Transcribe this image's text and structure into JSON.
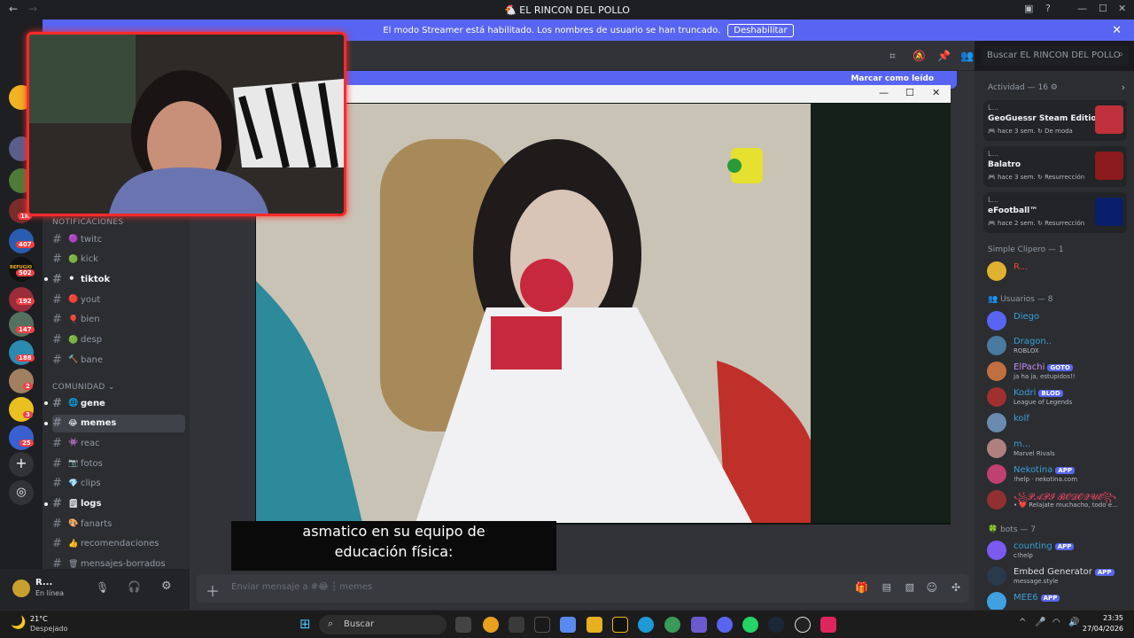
{
  "window": {
    "title": "EL RINCON DEL POLLO"
  },
  "banner": {
    "text": "El modo Streamer está habilitado. Los nombres de usuario se han truncado.",
    "button": "Deshabilitar"
  },
  "servers": {
    "badges": [
      "407",
      "502",
      "192",
      "147",
      "188",
      "2",
      "3",
      "25"
    ],
    "top_badge": "1K",
    "refugio": "REFUGIO"
  },
  "channels": {
    "cat_notif": "NOTIFICACIONES",
    "cat_comunidad": "COMUNIDAD",
    "notif": [
      {
        "emoji": "🟣",
        "label": "twitc",
        "unread": false
      },
      {
        "emoji": "🟢",
        "label": "kick",
        "unread": false
      },
      {
        "emoji": "⚫",
        "label": "tiktok",
        "unread": true
      },
      {
        "emoji": "🔴",
        "label": "yout",
        "unread": false
      },
      {
        "emoji": "🎈",
        "label": "bien",
        "unread": false
      },
      {
        "emoji": "🟢",
        "label": "desp",
        "unread": false
      },
      {
        "emoji": "🔨",
        "label": "bane",
        "unread": false
      }
    ],
    "comunidad": [
      {
        "emoji": "🌐",
        "label": "gene",
        "unread": true
      },
      {
        "emoji": "😂",
        "label": "memes",
        "unread": true
      },
      {
        "emoji": "👾",
        "label": "reac",
        "unread": false
      },
      {
        "emoji": "📷",
        "label": "fotos",
        "unread": false
      },
      {
        "emoji": "💎",
        "label": "clips",
        "unread": false
      },
      {
        "emoji": "🗒",
        "label": "logs",
        "unread": true
      },
      {
        "emoji": "🎨",
        "label": "fanarts",
        "unread": false
      },
      {
        "emoji": "👍",
        "label": "recomendaciones",
        "unread": false
      },
      {
        "emoji": "🗑",
        "label": "mensajes-borrados",
        "unread": false
      }
    ]
  },
  "userpanel": {
    "name": "R...",
    "status": "En línea"
  },
  "chat": {
    "mark_read": "Marcar como leído",
    "composer_placeholder": "Enviar mensaje a #😂 ┆ memes",
    "caption_line1": "asmatico en su equipo de",
    "caption_line2": "educación física:"
  },
  "search": {
    "placeholder": "Buscar EL RINCON DEL POLLO"
  },
  "members": {
    "activity_header": "Actividad — 16",
    "activities": [
      {
        "user": "L...",
        "game": "GeoGuessr Steam Edition",
        "meta": "hace 3 sem.",
        "tag": "De moda",
        "color": "#c0313b"
      },
      {
        "user": "L...",
        "game": "Balatro",
        "meta": "hace 3 sem.",
        "tag": "Resurrección",
        "color": "#8b1a1a"
      },
      {
        "user": "L...",
        "game": "eFootball™",
        "meta": "hace 2 sem.",
        "tag": "Resurrección",
        "color": "#0a1f6b"
      }
    ],
    "simple_header": "Simple Clipero — 1",
    "simple": [
      {
        "name": "R...",
        "color": "#f04a2a",
        "status": ""
      }
    ],
    "users_header": "Usuarios — 8",
    "users": [
      {
        "name": "Diego",
        "color": "#3aa0d8",
        "status": "",
        "tag": ""
      },
      {
        "name": "Dragon..",
        "color": "#3aa0d8",
        "status": "ROBLOX",
        "tag": ""
      },
      {
        "name": "ElPachi",
        "color": "#c78cf0",
        "status": "ja ha ja, estupidos!!",
        "tag": "GOTO"
      },
      {
        "name": "Kodri",
        "color": "#3aa0d8",
        "status": "League of Legends",
        "tag": "BLOD"
      },
      {
        "name": "kolf",
        "color": "#3aa0d8",
        "status": "",
        "tag": ""
      },
      {
        "name": "m...",
        "color": "#3aa0d8",
        "status": "Marvel Rivals",
        "tag": ""
      },
      {
        "name": "Nekotina",
        "color": "#3aa0d8",
        "status": "!help · nekotina.com",
        "tag": "APP"
      },
      {
        "name": "꧁𝓟𝓐𝓟𝓘 𝓑𝓞𝓓𝓞𝓠𝓤𝓔꧂",
        "color": "#e0425f",
        "status": "• ❤️ Relajate muchacho, todo e...",
        "tag": ""
      }
    ],
    "bots_header": "bots — 7",
    "bots": [
      {
        "name": "counting",
        "color": "#3aa0d8",
        "status": "c!help",
        "tag": "APP"
      },
      {
        "name": "Embed Generator",
        "color": "#dbdee1",
        "status": "message.style",
        "tag": "APP"
      },
      {
        "name": "MEE6",
        "color": "#3aa0d8",
        "status": "",
        "tag": "APP"
      }
    ]
  },
  "taskbar": {
    "weather_temp": "21°C",
    "weather_desc": "Despejado",
    "search": "Buscar",
    "time": "23:35",
    "date": "27/04/2026"
  }
}
